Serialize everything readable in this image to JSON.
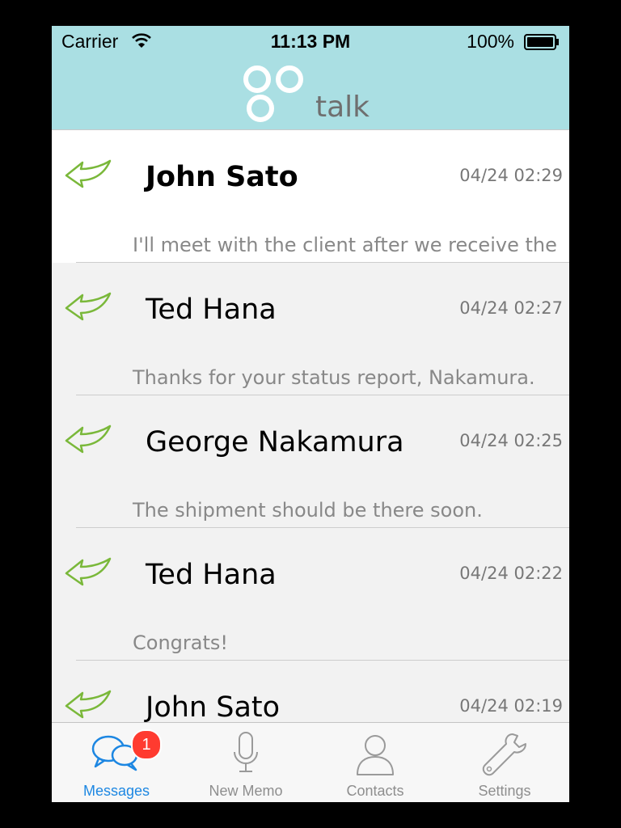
{
  "status_bar": {
    "carrier": "Carrier",
    "time": "11:13 PM",
    "battery": "100%"
  },
  "header": {
    "logo_text": "talk"
  },
  "messages": [
    {
      "name": "John Sato",
      "time": "04/24 02:29",
      "preview": "I'll meet with the client after we receive the",
      "unread": true
    },
    {
      "name": "Ted Hana",
      "time": "04/24 02:27",
      "preview": "Thanks for your status report, Nakamura.",
      "unread": false
    },
    {
      "name": "George Nakamura",
      "time": "04/24 02:25",
      "preview": "The shipment should be there soon.",
      "unread": false
    },
    {
      "name": "Ted Hana",
      "time": "04/24 02:22",
      "preview": "Congrats!",
      "unread": false
    },
    {
      "name": "John Sato",
      "time": "04/24 02:19",
      "preview": "",
      "unread": false
    }
  ],
  "tabs": [
    {
      "label": "Messages",
      "badge": "1",
      "active": true
    },
    {
      "label": "New Memo",
      "active": false
    },
    {
      "label": "Contacts",
      "active": false
    },
    {
      "label": "Settings",
      "active": false
    }
  ],
  "colors": {
    "header": "#aadfe3",
    "accent": "#1d87e2",
    "arrow": "#7ab83a",
    "badge": "#ff3b30"
  }
}
